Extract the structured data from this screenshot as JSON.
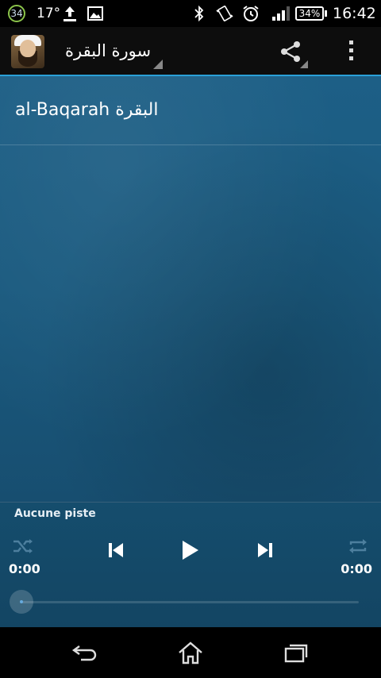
{
  "status_bar": {
    "notification_count": "34",
    "temperature": "17°",
    "battery": "34%",
    "time": "16:42"
  },
  "action_bar": {
    "title": "سورة البقرة",
    "app_icon": "reciter-avatar",
    "share_icon": "share-icon",
    "overflow_icon": "overflow-menu-icon"
  },
  "list": {
    "items": [
      {
        "label": "al-Baqarah البقرة"
      }
    ]
  },
  "player": {
    "track_name": "Aucune piste",
    "elapsed": "0:00",
    "duration": "0:00",
    "progress": 0
  },
  "colors": {
    "accent": "#2aa0d8",
    "background": "#1b5a80"
  }
}
